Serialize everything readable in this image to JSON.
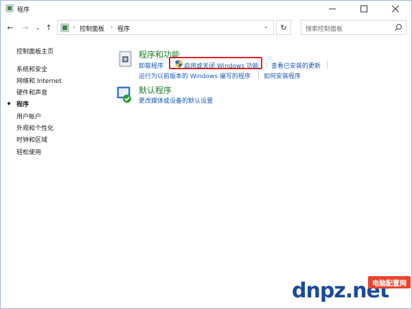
{
  "window": {
    "title": "程序"
  },
  "navbar": {
    "breadcrumbs": [
      "控制面板",
      "程序"
    ],
    "search_placeholder": "搜索控制面板"
  },
  "sidebar": {
    "items": [
      {
        "label": "控制面板主页",
        "selected": false
      },
      {
        "label": "系统和安全",
        "selected": false
      },
      {
        "label": "网络和 Internet",
        "selected": false
      },
      {
        "label": "硬件和声音",
        "selected": false
      },
      {
        "label": "程序",
        "selected": true
      },
      {
        "label": "用户帐户",
        "selected": false
      },
      {
        "label": "外观和个性化",
        "selected": false
      },
      {
        "label": "时钟和区域",
        "selected": false
      },
      {
        "label": "轻松使用",
        "selected": false
      }
    ]
  },
  "categories": [
    {
      "title": "程序和功能",
      "icon": "programs-features-icon",
      "links_row1": [
        "卸载程序",
        "启用或关闭 Windows 功能",
        "查看已安装的更新"
      ],
      "links_row2": [
        "运行为以前版本的 Windows 编写的程序",
        "如何安装程序"
      ]
    },
    {
      "title": "默认程序",
      "icon": "default-programs-icon",
      "links_row1": [
        "更改媒体或设备的默认设置"
      ]
    }
  ],
  "highlight_color": "#e21d1d",
  "watermark": {
    "brand": "dnpz.net",
    "badge": "电脑配置网"
  }
}
